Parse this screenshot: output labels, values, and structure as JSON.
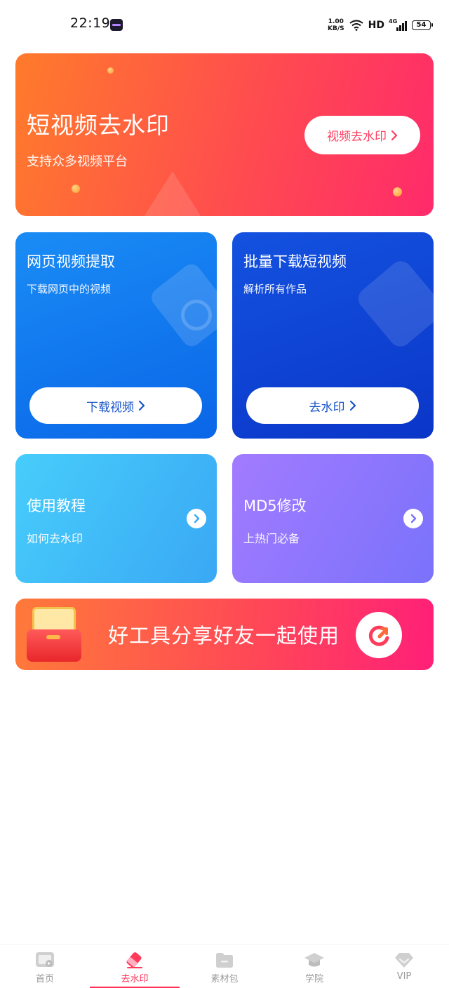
{
  "status_bar": {
    "time": "22:19",
    "net_speed_value": "1.00",
    "net_speed_unit": "KB/S",
    "wifi_icon": "wifi-icon",
    "hd": "HD",
    "network": "4G",
    "battery": "54"
  },
  "hero": {
    "title": "短视频去水印",
    "subtitle": "支持众多视频平台",
    "button_label": "视频去水印"
  },
  "web_extract": {
    "title": "网页视频提取",
    "subtitle": "下载网页中的视频",
    "button_label": "下载视频"
  },
  "batch_download": {
    "title": "批量下载短视频",
    "subtitle": "解析所有作品",
    "button_label": "去水印"
  },
  "tutorial": {
    "title": "使用教程",
    "subtitle": "如何去水印"
  },
  "md5": {
    "title": "MD5修改",
    "subtitle": "上热门必备"
  },
  "share_banner": {
    "text": "好工具分享好友一起使用"
  },
  "bottom_nav": {
    "items": [
      {
        "label": "首页",
        "icon": "home-video-icon",
        "active": false
      },
      {
        "label": "去水印",
        "icon": "eraser-icon",
        "active": true
      },
      {
        "label": "素材包",
        "icon": "folder-icon",
        "active": false
      },
      {
        "label": "学院",
        "icon": "graduation-cap-icon",
        "active": false
      },
      {
        "label": "VIP",
        "icon": "diamond-icon",
        "active": false
      }
    ]
  },
  "colors": {
    "accent": "#ff2f55",
    "blue_text": "#1855c9",
    "hero_start": "#ff7b2b",
    "hero_end": "#ff2a6b"
  }
}
